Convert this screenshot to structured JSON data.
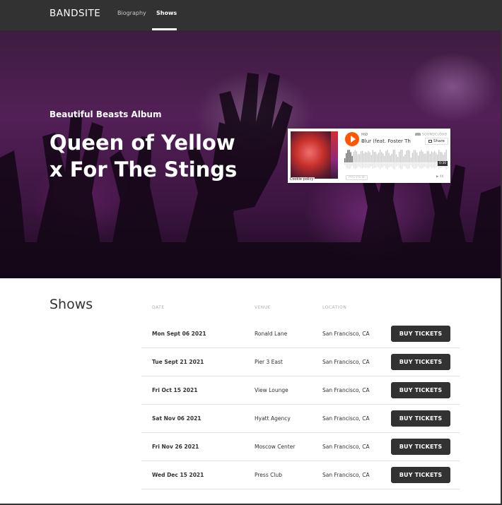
{
  "header": {
    "logo": "BANDSITE",
    "nav": [
      {
        "label": "Biography",
        "active": false
      },
      {
        "label": "Shows",
        "active": true
      }
    ]
  },
  "hero": {
    "subtitle": "Beautiful Beasts Album",
    "title_line1": "Queen of Yellow",
    "title_line2": "x For The Stings",
    "player": {
      "artist": "MØ",
      "track": "Blur (feat. Foster Th...",
      "brand": "SOUNDCLOUD",
      "share_label": "Share",
      "cookie_label": "Cookie policy",
      "preview_label": "PREVIEW",
      "duration": "0:30",
      "play_count": "4K",
      "accent_color": "#ff5500"
    }
  },
  "shows": {
    "title": "Shows",
    "columns": {
      "date": "DATE",
      "venue": "VENUE",
      "location": "LOCATION"
    },
    "button_label": "BUY TICKETS",
    "rows": [
      {
        "date": "Mon Sept 06 2021",
        "venue": "Ronald Lane",
        "location": "San Francisco, CA"
      },
      {
        "date": "Tue Sept 21 2021",
        "venue": "Pier 3 East",
        "location": "San Francisco, CA"
      },
      {
        "date": "Fri Oct 15 2021",
        "venue": "View Lounge",
        "location": "San Francisco, CA"
      },
      {
        "date": "Sat Nov 06 2021",
        "venue": "Hyatt Agency",
        "location": "San Francisco, CA"
      },
      {
        "date": "Fri Nov 26 2021",
        "venue": "Moscow Center",
        "location": "San Francisco, CA"
      },
      {
        "date": "Wed Dec 15 2021",
        "venue": "Press Club",
        "location": "San Francisco, CA"
      }
    ]
  },
  "colors": {
    "header_bg": "#323232",
    "text": "#323232",
    "muted": "#afafaf",
    "divider": "#e1e1e1",
    "hero_tint": "#7a2f80"
  }
}
